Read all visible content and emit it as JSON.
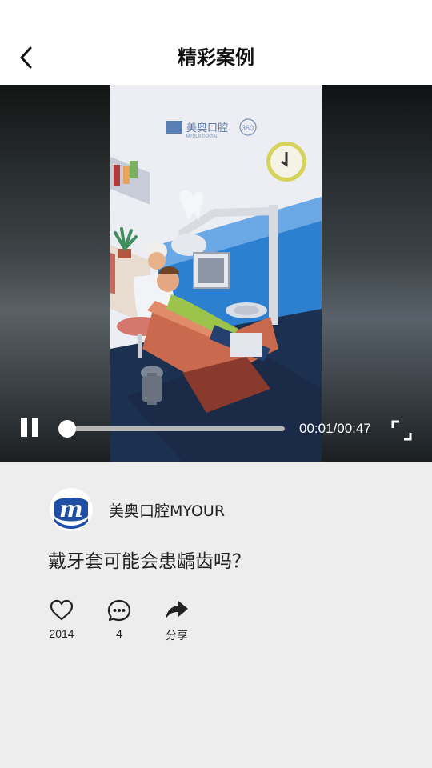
{
  "header": {
    "title": "精彩案例",
    "back_icon": "chevron-left-icon"
  },
  "video": {
    "watermark_brand": "美奥口腔",
    "watermark_sub": "MYOUR DENTAL",
    "watermark_badge": "360",
    "state": "playing",
    "controls": {
      "pause_icon": "pause-icon",
      "fullscreen_icon": "fullscreen-icon",
      "current_time": "00:01",
      "total_time": "00:47",
      "time_label": "00:01/00:47",
      "progress_fraction": 0.021
    }
  },
  "author": {
    "name": "美奥口腔MYOUR",
    "avatar_letter": "m",
    "brand_color": "#1e4fa5"
  },
  "post": {
    "title": "戴牙套可能会患龋齿吗？"
  },
  "actions": [
    {
      "icon": "heart-icon",
      "label": "2014"
    },
    {
      "icon": "comment-icon",
      "label": "4"
    },
    {
      "icon": "share-icon",
      "label": "分享"
    }
  ]
}
